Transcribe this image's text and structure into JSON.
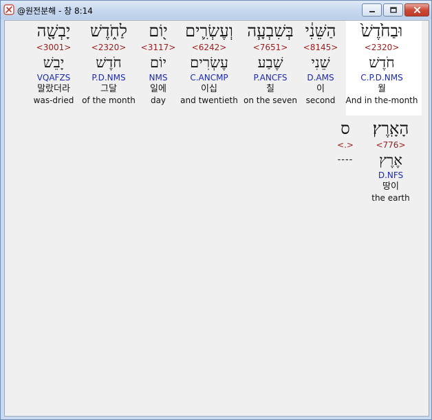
{
  "window": {
    "title": "@원전분해 - 창 8:14",
    "buttons": {
      "minimize": "minimize",
      "maximize": "maximize",
      "close": "close"
    }
  },
  "row1": [
    {
      "hebrew": "וּבַחֹ֙דֶשׁ֙",
      "strong": "<2320>",
      "lemma": "חֹדֶשׁ",
      "parse": "C.P.D.NMS",
      "korean": "월",
      "english": "And in the-month"
    },
    {
      "hebrew": "הַשֵּׁנִ֔י",
      "strong": "<8145>",
      "lemma": "שֵׁנִי",
      "parse": "D.AMS",
      "korean": "이",
      "english": "second"
    },
    {
      "hebrew": "בְּשִׁבְעָ֧ה",
      "strong": "<7651>",
      "lemma": "שֶׁבַע",
      "parse": "P.ANCFS",
      "korean": "칠",
      "english": "on the seven"
    },
    {
      "hebrew": "וְעֶשְׂרִ֛ים",
      "strong": "<6242>",
      "lemma": "עֶשְׂרִים",
      "parse": "C.ANCMP",
      "korean": "이십",
      "english": "and twentieth"
    },
    {
      "hebrew": "י֖וֹם",
      "strong": "<3117>",
      "lemma": "יוֹם",
      "parse": "NMS",
      "korean": "일에",
      "english": "day"
    },
    {
      "hebrew": "לַחֹ֑דֶשׁ",
      "strong": "<2320>",
      "lemma": "חֹדֶשׁ",
      "parse": "P.D.NMS",
      "korean": "그달",
      "english": "of the month"
    },
    {
      "hebrew": "יָבְשָׁ֖ה",
      "strong": "<3001>",
      "lemma": "יָבֵשׁ",
      "parse": "VQAFZS",
      "korean": "말랐더라",
      "english": "was-dried"
    }
  ],
  "row2": [
    {
      "hebrew": "הָאָֽרֶץ׃",
      "strong": "<776>",
      "lemma": "אֶרֶץ",
      "parse": "D.NFS",
      "korean": "땅이",
      "english": "the earth"
    },
    {
      "hebrew": "ס",
      "strong": "<.>",
      "lemma": "----",
      "parse": "",
      "korean": "",
      "english": ""
    }
  ]
}
